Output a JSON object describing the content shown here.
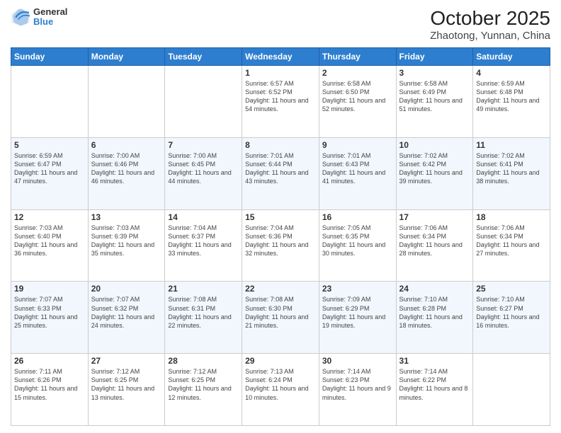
{
  "header": {
    "logo_line1": "General",
    "logo_line2": "Blue",
    "title": "October 2025",
    "subtitle": "Zhaotong, Yunnan, China"
  },
  "days_of_week": [
    "Sunday",
    "Monday",
    "Tuesday",
    "Wednesday",
    "Thursday",
    "Friday",
    "Saturday"
  ],
  "weeks": [
    [
      {
        "day": "",
        "text": ""
      },
      {
        "day": "",
        "text": ""
      },
      {
        "day": "",
        "text": ""
      },
      {
        "day": "1",
        "text": "Sunrise: 6:57 AM\nSunset: 6:52 PM\nDaylight: 11 hours and 54 minutes."
      },
      {
        "day": "2",
        "text": "Sunrise: 6:58 AM\nSunset: 6:50 PM\nDaylight: 11 hours and 52 minutes."
      },
      {
        "day": "3",
        "text": "Sunrise: 6:58 AM\nSunset: 6:49 PM\nDaylight: 11 hours and 51 minutes."
      },
      {
        "day": "4",
        "text": "Sunrise: 6:59 AM\nSunset: 6:48 PM\nDaylight: 11 hours and 49 minutes."
      }
    ],
    [
      {
        "day": "5",
        "text": "Sunrise: 6:59 AM\nSunset: 6:47 PM\nDaylight: 11 hours and 47 minutes."
      },
      {
        "day": "6",
        "text": "Sunrise: 7:00 AM\nSunset: 6:46 PM\nDaylight: 11 hours and 46 minutes."
      },
      {
        "day": "7",
        "text": "Sunrise: 7:00 AM\nSunset: 6:45 PM\nDaylight: 11 hours and 44 minutes."
      },
      {
        "day": "8",
        "text": "Sunrise: 7:01 AM\nSunset: 6:44 PM\nDaylight: 11 hours and 43 minutes."
      },
      {
        "day": "9",
        "text": "Sunrise: 7:01 AM\nSunset: 6:43 PM\nDaylight: 11 hours and 41 minutes."
      },
      {
        "day": "10",
        "text": "Sunrise: 7:02 AM\nSunset: 6:42 PM\nDaylight: 11 hours and 39 minutes."
      },
      {
        "day": "11",
        "text": "Sunrise: 7:02 AM\nSunset: 6:41 PM\nDaylight: 11 hours and 38 minutes."
      }
    ],
    [
      {
        "day": "12",
        "text": "Sunrise: 7:03 AM\nSunset: 6:40 PM\nDaylight: 11 hours and 36 minutes."
      },
      {
        "day": "13",
        "text": "Sunrise: 7:03 AM\nSunset: 6:39 PM\nDaylight: 11 hours and 35 minutes."
      },
      {
        "day": "14",
        "text": "Sunrise: 7:04 AM\nSunset: 6:37 PM\nDaylight: 11 hours and 33 minutes."
      },
      {
        "day": "15",
        "text": "Sunrise: 7:04 AM\nSunset: 6:36 PM\nDaylight: 11 hours and 32 minutes."
      },
      {
        "day": "16",
        "text": "Sunrise: 7:05 AM\nSunset: 6:35 PM\nDaylight: 11 hours and 30 minutes."
      },
      {
        "day": "17",
        "text": "Sunrise: 7:06 AM\nSunset: 6:34 PM\nDaylight: 11 hours and 28 minutes."
      },
      {
        "day": "18",
        "text": "Sunrise: 7:06 AM\nSunset: 6:34 PM\nDaylight: 11 hours and 27 minutes."
      }
    ],
    [
      {
        "day": "19",
        "text": "Sunrise: 7:07 AM\nSunset: 6:33 PM\nDaylight: 11 hours and 25 minutes."
      },
      {
        "day": "20",
        "text": "Sunrise: 7:07 AM\nSunset: 6:32 PM\nDaylight: 11 hours and 24 minutes."
      },
      {
        "day": "21",
        "text": "Sunrise: 7:08 AM\nSunset: 6:31 PM\nDaylight: 11 hours and 22 minutes."
      },
      {
        "day": "22",
        "text": "Sunrise: 7:08 AM\nSunset: 6:30 PM\nDaylight: 11 hours and 21 minutes."
      },
      {
        "day": "23",
        "text": "Sunrise: 7:09 AM\nSunset: 6:29 PM\nDaylight: 11 hours and 19 minutes."
      },
      {
        "day": "24",
        "text": "Sunrise: 7:10 AM\nSunset: 6:28 PM\nDaylight: 11 hours and 18 minutes."
      },
      {
        "day": "25",
        "text": "Sunrise: 7:10 AM\nSunset: 6:27 PM\nDaylight: 11 hours and 16 minutes."
      }
    ],
    [
      {
        "day": "26",
        "text": "Sunrise: 7:11 AM\nSunset: 6:26 PM\nDaylight: 11 hours and 15 minutes."
      },
      {
        "day": "27",
        "text": "Sunrise: 7:12 AM\nSunset: 6:25 PM\nDaylight: 11 hours and 13 minutes."
      },
      {
        "day": "28",
        "text": "Sunrise: 7:12 AM\nSunset: 6:25 PM\nDaylight: 11 hours and 12 minutes."
      },
      {
        "day": "29",
        "text": "Sunrise: 7:13 AM\nSunset: 6:24 PM\nDaylight: 11 hours and 10 minutes."
      },
      {
        "day": "30",
        "text": "Sunrise: 7:14 AM\nSunset: 6:23 PM\nDaylight: 11 hours and 9 minutes."
      },
      {
        "day": "31",
        "text": "Sunrise: 7:14 AM\nSunset: 6:22 PM\nDaylight: 11 hours and 8 minutes."
      },
      {
        "day": "",
        "text": ""
      }
    ]
  ]
}
